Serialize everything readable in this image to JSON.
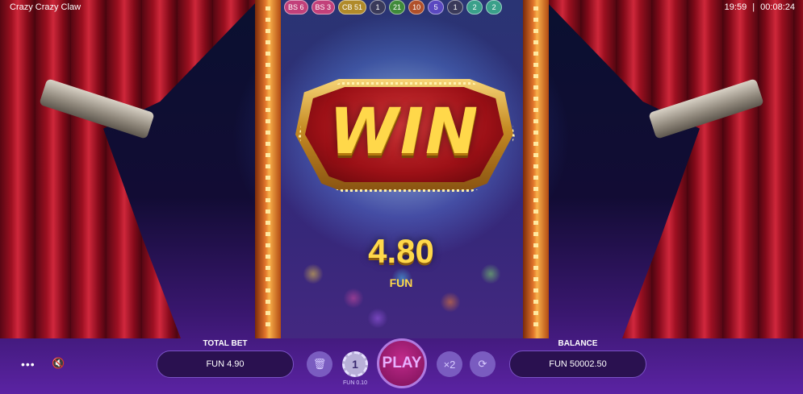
{
  "app": {
    "title": "Crazy Crazy Claw",
    "clock": "19:59",
    "session_timer": "00:08:24",
    "clock_separator": "|"
  },
  "history_chips": [
    {
      "label": "BS 6",
      "color": "#c2407a"
    },
    {
      "label": "BS 3",
      "color": "#c2407a"
    },
    {
      "label": "CB 51",
      "color": "#b08a2a"
    },
    {
      "label": "1",
      "color": "#3a3a5a"
    },
    {
      "label": "21",
      "color": "#3f8a3a"
    },
    {
      "label": "10",
      "color": "#b0502a"
    },
    {
      "label": "5",
      "color": "#5a48c0"
    },
    {
      "label": "1",
      "color": "#3a3a5a"
    },
    {
      "label": "2",
      "color": "#3aa08a"
    },
    {
      "label": "2",
      "color": "#3aa08a"
    }
  ],
  "win": {
    "title": "WIN",
    "amount": "4.80",
    "currency": "FUN"
  },
  "controls": {
    "total_bet_label": "TOTAL BET",
    "total_bet_value": "FUN 4.90",
    "balance_label": "BALANCE",
    "balance_value": "FUN 50002.50",
    "play_label": "PLAY",
    "coin_value": "1",
    "coin_label": "FUN 0.10",
    "multiplier_label": "×2",
    "menu_glyph": "•••",
    "mute_glyph": "🔇",
    "clear_glyph": "🗑",
    "autoplay_glyph": "⟳"
  }
}
